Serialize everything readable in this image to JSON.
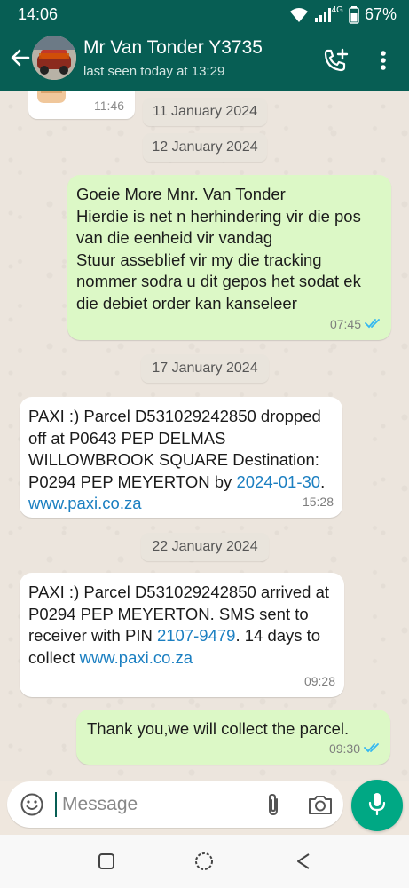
{
  "status_bar": {
    "time": "14:06",
    "network": "4G",
    "battery": "67%"
  },
  "header": {
    "contact_name": "Mr Van Tonder Y3735",
    "last_seen": "last seen today at 13:29",
    "avatar_text": "Auto Repair",
    "icons": [
      "back-arrow-icon",
      "add-call-icon",
      "more-vert-icon"
    ]
  },
  "chat": {
    "sticker": {
      "time": "11:46"
    },
    "dates": [
      "11 January 2024",
      "12 January 2024",
      "17 January 2024",
      "22 January 2024"
    ],
    "messages": [
      {
        "direction": "out",
        "text": "Goeie More Mnr. Van Tonder\nHierdie is net n herhindering vir die pos van die eenheid vir vandag\nStuur asseblief vir my die tracking nommer sodra u dit gepos het sodat ek die debiet order kan kanseleer",
        "time": "07:45",
        "status": "read"
      },
      {
        "direction": "in",
        "text_1": "PAXI :) Parcel D531029242850 dropped off at P0643 PEP DELMAS WILLOWBROOK SQUARE Destination: P0294 PEP MEYERTON by ",
        "link_1": "2024-01-30",
        "text_2": ". ",
        "link_2": "www.paxi.co.za",
        "time": "15:28"
      },
      {
        "direction": "in",
        "text_1": "PAXI :) Parcel D531029242850 arrived at P0294 PEP MEYERTON. SMS sent to receiver with PIN ",
        "link_1": "2107-9479",
        "text_2": ". 14 days to collect ",
        "link_2": "www.paxi.co.za",
        "time": "09:28"
      },
      {
        "direction": "out",
        "text": "Thank you,we will collect the parcel.",
        "time": "09:30",
        "status": "read"
      }
    ]
  },
  "composer": {
    "placeholder": "Message"
  },
  "colors": {
    "header": "#075e54",
    "outgoing": "#dcf8c6",
    "incoming": "#ffffff",
    "accent": "#00a884",
    "read_ticks": "#34b7f1",
    "link": "#1b7fc1"
  }
}
